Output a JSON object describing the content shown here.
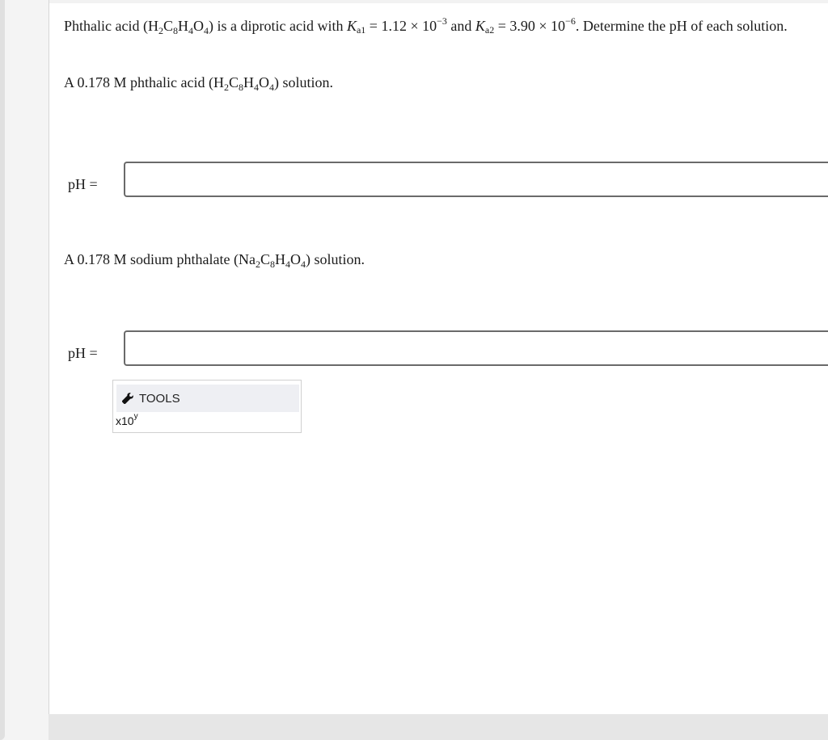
{
  "question": {
    "intro_prefix": "Phthalic acid (H",
    "intro_formula": [
      "2",
      "C",
      "8",
      "H",
      "4",
      "O",
      "4"
    ],
    "intro_middle": ") is a diprotic acid with ",
    "ka1_symbol": "K",
    "ka1_subscript": "a1",
    "equals": " = ",
    "ka1_mantissa": "1.12 × 10",
    "ka1_exponent": "−3",
    "and_text": " and ",
    "ka2_symbol": "K",
    "ka2_subscript": "a2",
    "ka2_mantissa": "3.90 × 10",
    "ka2_exponent": "−6",
    "tail": ". Determine the pH of each solution."
  },
  "parts": [
    {
      "prefix": "A 0.178 M phthalic acid (H",
      "suffix": ") solution.",
      "label": "pH =",
      "answer_value": ""
    },
    {
      "prefix": "A 0.178 M sodium phthalate (Na",
      "suffix": ") solution.",
      "label": "pH =",
      "answer_value": ""
    }
  ],
  "tools": {
    "header_label": "TOOLS",
    "header_icon": "wrench-icon",
    "sci_button_base": "x10",
    "sci_button_exp": "y"
  },
  "colors": {
    "input_border": "#6a6a6a",
    "tools_header_bg": "#eeeff3"
  }
}
